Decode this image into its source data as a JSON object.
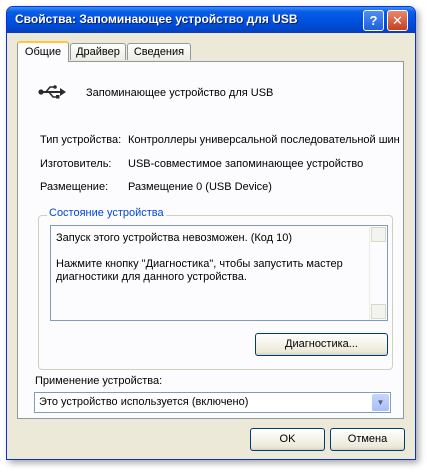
{
  "window": {
    "title": "Свойства: Запоминающее устройство для USB",
    "help_label": "?",
    "close_label": "✕"
  },
  "tabs": [
    {
      "label": "Общие",
      "active": true
    },
    {
      "label": "Драйвер",
      "active": false
    },
    {
      "label": "Сведения",
      "active": false
    }
  ],
  "device": {
    "icon": "usb-icon",
    "name": "Запоминающее устройство для USB"
  },
  "properties": [
    {
      "label": "Тип устройства:",
      "value": "Контроллеры универсальной последовательной шин"
    },
    {
      "label": "Изготовитель:",
      "value": "USB-совместимое запоминающее устройство"
    },
    {
      "label": "Размещение:",
      "value": "Размещение 0 (USB Device)"
    }
  ],
  "status_group": {
    "legend": "Состояние устройства",
    "line1": "Запуск этого устройства невозможен. (Код 10)",
    "line2": "Нажмите кнопку \"Диагностика\", чтобы запустить мастер диагностики для данного устройства.",
    "diagnostics_button": "Диагностика..."
  },
  "usage": {
    "label": "Применение устройства:",
    "selected": "Это устройство используется (включено)"
  },
  "footer": {
    "ok_button": "OK",
    "cancel_button": "Отмена"
  },
  "colors": {
    "titlebar": "#0054e3",
    "dialog_bg": "#ece9d8",
    "group_legend": "#0046d5",
    "active_tab_accent": "#ffc83c"
  }
}
